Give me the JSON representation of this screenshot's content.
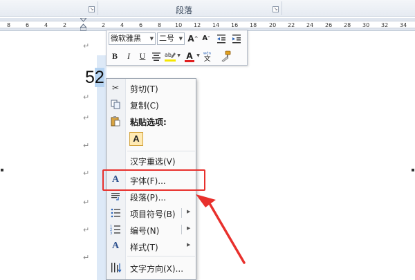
{
  "ribbon": {
    "group_title": "段落"
  },
  "ruler": {
    "numbers": [
      "8",
      "6",
      "4",
      "2",
      "2",
      "4",
      "6",
      "8",
      "10",
      "12",
      "14",
      "16",
      "18",
      "20",
      "22",
      "24",
      "26",
      "28",
      "30",
      "32",
      "34"
    ]
  },
  "document": {
    "text_before": "5",
    "selected_text": "2",
    "paragraph_mark": "↵"
  },
  "mini_toolbar": {
    "font_name": "微软雅黑",
    "font_size": "二号",
    "grow_font": "A",
    "shrink_font": "A",
    "bold": "B",
    "italic": "I",
    "underline": "U",
    "font_color_glyph": "A"
  },
  "context_menu": {
    "items": [
      {
        "label": "剪切(T)",
        "icon": "scissors-icon"
      },
      {
        "label": "复制(C)",
        "icon": "copy-icon"
      },
      {
        "label": "粘贴选项:",
        "icon": "clipboard-icon"
      },
      {
        "label": "A",
        "icon": "paste-keep-text-icon"
      },
      {
        "label": "汉字重选(V)",
        "icon": ""
      },
      {
        "label": "字体(F)...",
        "icon": "font-icon"
      },
      {
        "label": "段落(P)...",
        "icon": "paragraph-icon"
      },
      {
        "label": "项目符号(B)",
        "icon": "bullets-icon"
      },
      {
        "label": "编号(N)",
        "icon": "numbering-icon"
      },
      {
        "label": "样式(T)",
        "icon": "styles-icon"
      },
      {
        "label": "文字方向(X)...",
        "icon": "text-direction-icon"
      }
    ]
  },
  "colors": {
    "annotation": "#e8302c",
    "selection": "#b6d4f2",
    "highlight_marker": "#f5e600",
    "font_color_bar": "#e02020"
  }
}
